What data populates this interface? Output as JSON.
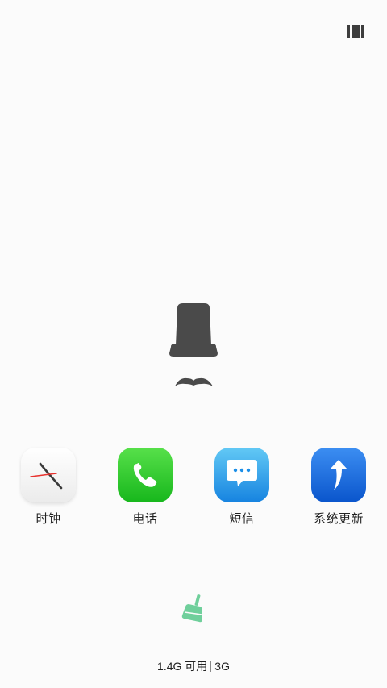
{
  "icons": {
    "recents": "recents-grid-icon",
    "mascot": "top-hat-mustache-icon",
    "broom": "broom-clean-icon"
  },
  "apps": [
    {
      "label": "时钟",
      "icon": "clock-icon"
    },
    {
      "label": "电话",
      "icon": "phone-icon"
    },
    {
      "label": "短信",
      "icon": "message-icon"
    },
    {
      "label": "系统更新",
      "icon": "update-arrow-icon"
    }
  ],
  "status": {
    "memory": "1.4G 可用",
    "network": "3G"
  },
  "colors": {
    "background": "#fbfbfb",
    "mascot": "#4a4a4a",
    "broom": "#6fcf9b",
    "phone": "#22c02a",
    "sms": "#2a9ff0",
    "update": "#1769e0"
  }
}
